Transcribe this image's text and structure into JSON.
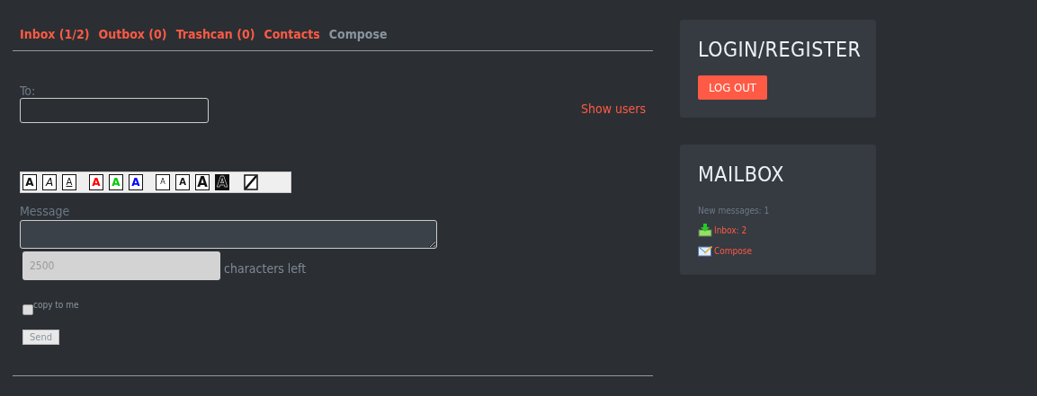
{
  "tabs": [
    {
      "label": "Inbox (1/2)",
      "selected": false
    },
    {
      "label": "Outbox (0)",
      "selected": false
    },
    {
      "label": "Trashcan (0)",
      "selected": false
    },
    {
      "label": "Contacts",
      "selected": false
    },
    {
      "label": "Compose",
      "selected": true
    }
  ],
  "to": {
    "label": "To:",
    "show_users": "Show users"
  },
  "format_buttons": [
    {
      "kind": "bold",
      "label": "A"
    },
    {
      "kind": "italic",
      "label": "A"
    },
    {
      "kind": "underline",
      "label": "A"
    },
    {
      "kind": "red",
      "label": "A"
    },
    {
      "kind": "green",
      "label": "A"
    },
    {
      "kind": "blue",
      "label": "A"
    },
    {
      "kind": "tiny",
      "label": "A"
    },
    {
      "kind": "small",
      "label": "A"
    },
    {
      "kind": "large",
      "label": "A"
    },
    {
      "kind": "huge",
      "label": "A"
    },
    {
      "kind": "line"
    }
  ],
  "message": {
    "label": "Message",
    "counter": "2500",
    "counter_label": "characters left",
    "copy_label": "copy to me",
    "copy_checked": false,
    "send": "Send"
  },
  "login": {
    "title": "LOGIN/REGISTER",
    "button": "LOG OUT"
  },
  "mailbox": {
    "title": "MAILBOX",
    "new_messages": "New messages: 1",
    "links": [
      {
        "kind": "inbox",
        "label": "Inbox: 2"
      },
      {
        "kind": "compose",
        "label": "Compose"
      }
    ]
  }
}
